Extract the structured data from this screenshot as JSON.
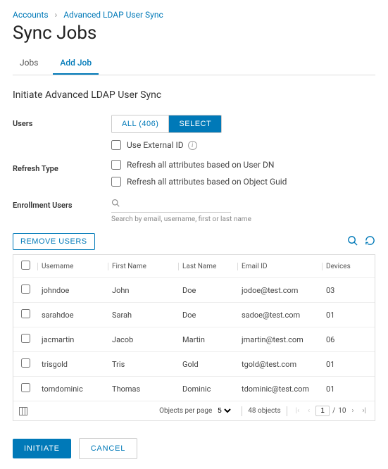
{
  "breadcrumb": {
    "level1": "Accounts",
    "level2": "Advanced LDAP User Sync"
  },
  "page_title": "Sync Jobs",
  "tabs": {
    "jobs": "Jobs",
    "add_job": "Add Job"
  },
  "section_title": "Initiate Advanced LDAP User Sync",
  "labels": {
    "users": "Users",
    "refresh_type": "Refresh Type",
    "enrollment_users": "Enrollment Users"
  },
  "users_toggle": {
    "all": "ALL (406)",
    "select": "SELECT"
  },
  "checkboxes": {
    "use_external_id": "Use External ID",
    "refresh_user_dn": "Refresh all attributes based on User DN",
    "refresh_object_guid": "Refresh all attributes based on Object Guid"
  },
  "search": {
    "placeholder": "",
    "hint": "Search by email, username, first or last name"
  },
  "actions": {
    "remove_users": "REMOVE USERS"
  },
  "columns": {
    "username": "Username",
    "first_name": "First Name",
    "last_name": "Last Name",
    "email": "Email ID",
    "devices": "Devices"
  },
  "rows": [
    {
      "username": "johndoe",
      "first": "John",
      "last": "Doe",
      "email": "jodoe@test.com",
      "devices": "03"
    },
    {
      "username": "sarahdoe",
      "first": "Sarah",
      "last": "Doe",
      "email": "sadoe@test.com",
      "devices": "01"
    },
    {
      "username": "jacmartin",
      "first": "Jacob",
      "last": "Martin",
      "email": "jmartin@test.com",
      "devices": "06"
    },
    {
      "username": "trisgold",
      "first": "Tris",
      "last": "Gold",
      "email": "tgold@test.com",
      "devices": "01"
    },
    {
      "username": "tomdominic",
      "first": "Thomas",
      "last": "Dominic",
      "email": "tdominic@test.com",
      "devices": "01"
    }
  ],
  "pagination": {
    "per_page_label": "Objects per page",
    "per_page_value": "5",
    "total_label": "48 objects",
    "current_page": "1",
    "total_pages": "10"
  },
  "buttons": {
    "initiate": "INITIATE",
    "cancel": "CANCEL"
  }
}
